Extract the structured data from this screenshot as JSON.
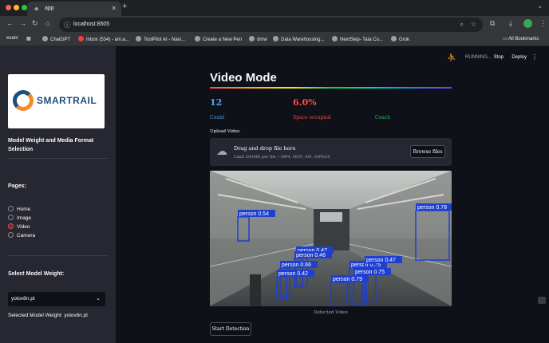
{
  "browser": {
    "tab_title": "app",
    "url": "localhost:8505",
    "bookmarks": [
      {
        "label": "exam"
      },
      {
        "label": "ChatGPT"
      },
      {
        "label": "Inbox (534) - ani.a..."
      },
      {
        "label": "ToolPilot AI - Navi..."
      },
      {
        "label": "Create a New Pen"
      },
      {
        "label": "dmw"
      },
      {
        "label": "Data Warehousing..."
      },
      {
        "label": "NextStep- Tata Co..."
      },
      {
        "label": "Grok"
      },
      {
        "label": "All Bookmarks"
      }
    ]
  },
  "sidebar": {
    "logo_text": "SMARTRAIL",
    "section_title": "Model Weight and Media Format Selection",
    "pages_heading": "Pages:",
    "pages": [
      {
        "label": "Home",
        "selected": false
      },
      {
        "label": "Image",
        "selected": false
      },
      {
        "label": "Video",
        "selected": true
      },
      {
        "label": "Camera",
        "selected": false
      }
    ],
    "model_heading": "Select Model Weight:",
    "model_value": "yolov8n.pt",
    "selected_text": "Selected Model Weight: yolov8n.pt"
  },
  "header": {
    "status": "RUNNING...",
    "stop_label": "Stop",
    "deploy_label": "Deploy"
  },
  "main": {
    "title": "Video Mode",
    "metrics": [
      {
        "value": "12",
        "label": "Count",
        "value_color": "#4da3ff",
        "label_color": "#4da3ff"
      },
      {
        "value": "6.0%",
        "label": "Space occupied",
        "value_color": "#ff4b4b",
        "label_color": "#ff4b4b"
      },
      {
        "value": "",
        "label": "Coach",
        "value_color": "#21c354",
        "label_color": "#21c354"
      }
    ],
    "upload_label": "Upload Video",
    "uploader_main": "Drag and drop file here",
    "uploader_sub": "Limit 200MB per file • MP4, MOV, AVI, MPEG4",
    "browse_label": "Browse files",
    "caption": "Detected Video",
    "start_label": "Start Detection",
    "detections": [
      {
        "label": "person 0.54"
      },
      {
        "label": "person 0.78"
      },
      {
        "label": "person 0.47"
      },
      {
        "label": "person 0.46"
      },
      {
        "label": "person 0.66"
      },
      {
        "label": "person 0.42"
      },
      {
        "label": "person 0.25"
      },
      {
        "label": "person 0.47"
      },
      {
        "label": "person 0.75"
      },
      {
        "label": "person 0.79"
      }
    ]
  }
}
